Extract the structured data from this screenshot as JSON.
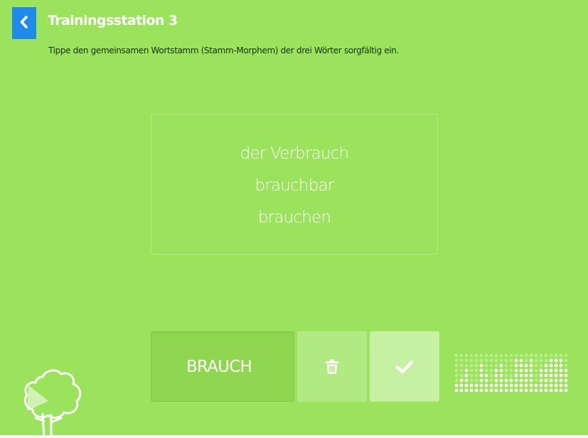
{
  "header": {
    "title": "Trainingsstation 3",
    "instruction": "Tippe den gemeinsamen Wortstamm (Stamm-Morphem) der drei Wörter sorgfältig ein."
  },
  "task": {
    "words": [
      "der Verbrauch",
      "brauchbar",
      "brauchen"
    ]
  },
  "answer": {
    "value": "BRAUCH"
  },
  "progress": {
    "column_levels": [
      2,
      3,
      5,
      2,
      2,
      6,
      4,
      2,
      5,
      6,
      3,
      3,
      7,
      7,
      6,
      7,
      2,
      5,
      6,
      7,
      7,
      7,
      5
    ]
  },
  "icons": {
    "back": "chevron-left-icon",
    "delete": "trash-icon",
    "confirm": "check-icon",
    "logo": "tree-icon"
  },
  "colors": {
    "background": "#9be35c",
    "back_button": "#1e8bea",
    "input_background": "#8fd651",
    "delete_button": "#b1ea82",
    "confirm_button": "#c6f1a3",
    "text": "#ffffff"
  }
}
